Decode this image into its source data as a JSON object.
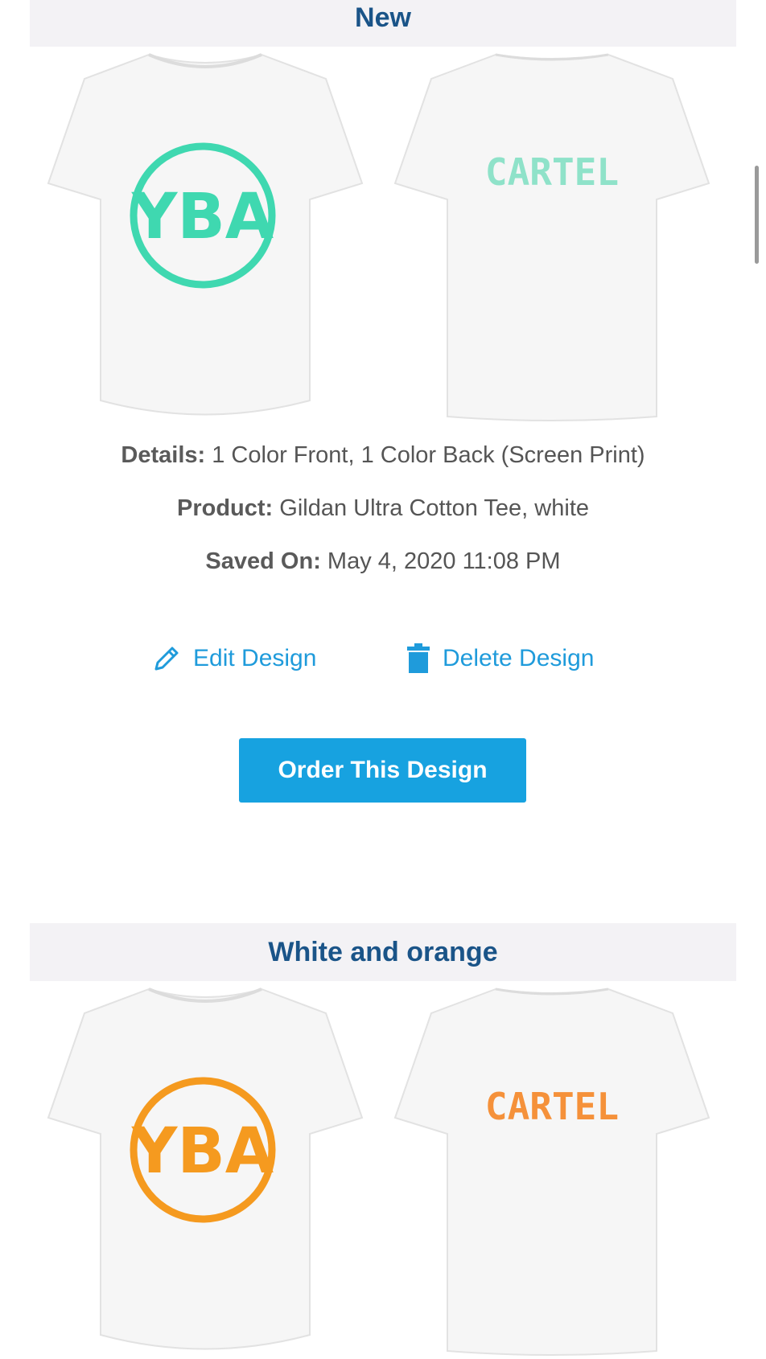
{
  "designs": [
    {
      "name": "New",
      "accent_color": "#3fd8b0",
      "front_logo_text": "YBA",
      "back_text": "CARTEL",
      "details_label": "Details:",
      "details_value": "1 Color Front, 1 Color Back (Screen Print)",
      "product_label": "Product:",
      "product_value": "Gildan Ultra Cotton Tee, white",
      "saved_label": "Saved On:",
      "saved_value": "May 4, 2020 11:08 PM",
      "edit_label": "Edit Design",
      "delete_label": "Delete Design",
      "order_label": "Order This Design"
    },
    {
      "name": "White and orange",
      "accent_color": "#f59a1f",
      "front_logo_text": "YBA",
      "back_text": "CARTEL"
    }
  ],
  "icons": {
    "edit": "pencil-icon",
    "delete": "trash-icon"
  },
  "colors": {
    "header_text": "#1a5488",
    "header_bg": "#f3f2f5",
    "link": "#1f9bdb",
    "button": "#17a2e0"
  }
}
